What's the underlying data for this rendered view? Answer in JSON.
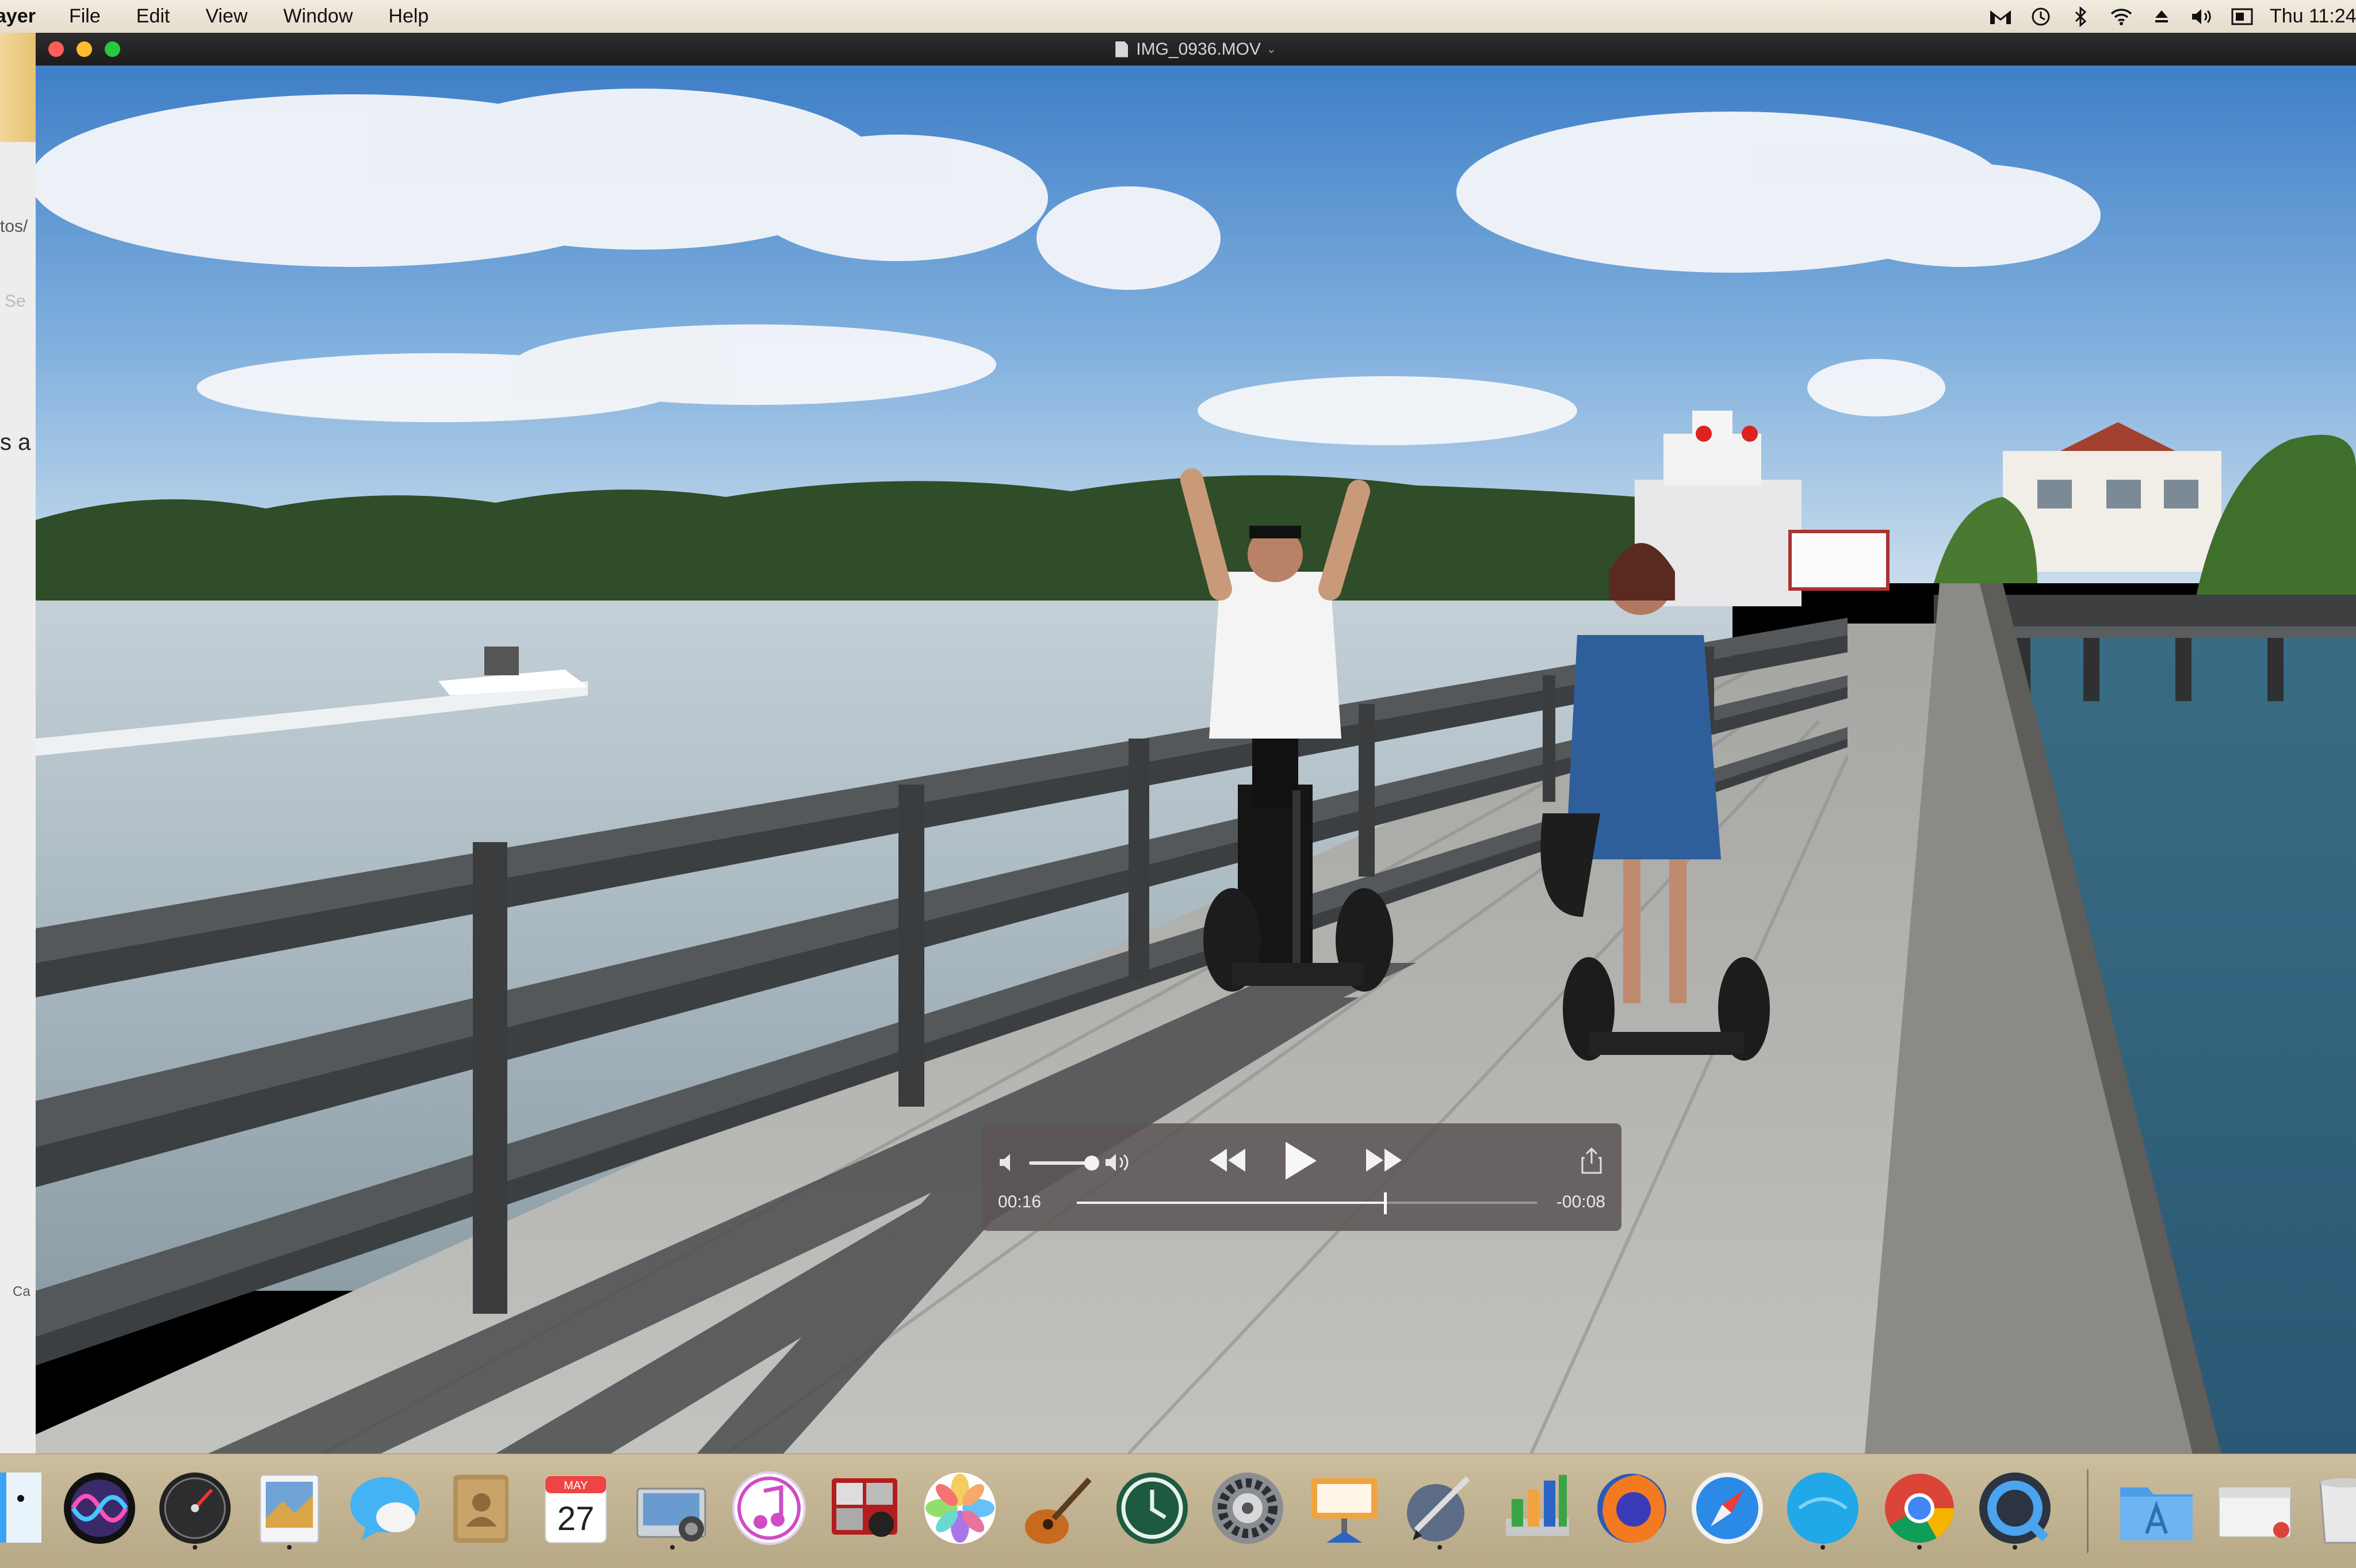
{
  "menubar": {
    "app_name": "ayer",
    "items": [
      "File",
      "Edit",
      "View",
      "Window",
      "Help"
    ],
    "clock": "Thu 11:24"
  },
  "background_window": {
    "fragments": [
      "tos/",
      "Se",
      "s a",
      "Ca"
    ]
  },
  "player": {
    "window_title": "IMG_0936.MOV",
    "controls": {
      "elapsed": "00:16",
      "remaining": "-00:08",
      "progress": 0.67,
      "volume": 0.85
    }
  },
  "dock": {
    "apps": [
      "Finder",
      "Siri",
      "Dashboard",
      "Preview",
      "Messages",
      "Contacts",
      "Calendar",
      "Image Capture",
      "iTunes",
      "Photo Booth",
      "Photos",
      "GarageBand",
      "Time Machine",
      "System Preferences",
      "Keynote",
      "Script Editor",
      "Numbers",
      "Firefox",
      "Safari",
      "Skype",
      "Chrome",
      "QuickTime Player",
      "Applications",
      "Downloads",
      "Trash"
    ],
    "calendar": {
      "month": "MAY",
      "day": "27"
    }
  },
  "colors": {
    "accent_close": "#ff5f57",
    "accent_minimize": "#febc2e",
    "accent_zoom": "#28c840",
    "hud_background": "#5c5454"
  }
}
